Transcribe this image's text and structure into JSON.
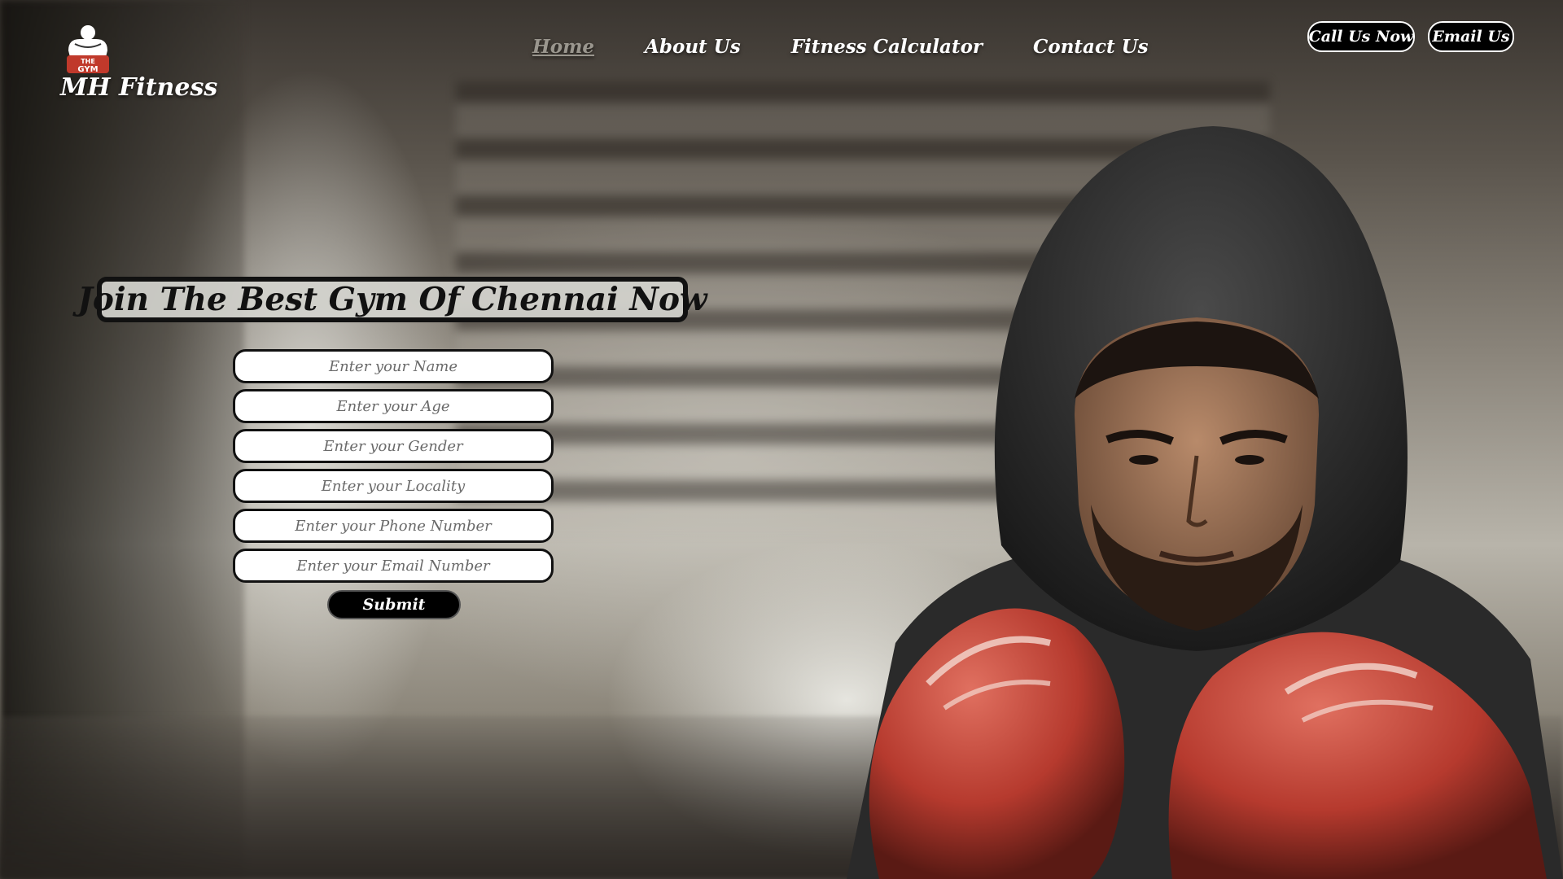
{
  "brand": {
    "logo_text_top": "THE",
    "logo_text_bottom": "GYM",
    "name": "MH Fitness"
  },
  "nav": {
    "items": [
      {
        "label": "Home",
        "active": true
      },
      {
        "label": "About Us",
        "active": false
      },
      {
        "label": "Fitness Calculator",
        "active": false
      },
      {
        "label": "Contact Us",
        "active": false
      }
    ]
  },
  "header_actions": {
    "call_label": "Call Us Now",
    "email_label": "Email Us"
  },
  "hero": {
    "title": "Join The Best Gym Of Chennai Now"
  },
  "form": {
    "fields": [
      {
        "placeholder": "Enter your Name",
        "value": ""
      },
      {
        "placeholder": "Enter your Age",
        "value": ""
      },
      {
        "placeholder": "Enter your Gender",
        "value": ""
      },
      {
        "placeholder": "Enter your Locality",
        "value": ""
      },
      {
        "placeholder": "Enter your Phone Number",
        "value": ""
      },
      {
        "placeholder": "Enter your Email Number",
        "value": ""
      }
    ],
    "submit_label": "Submit"
  },
  "colors": {
    "accent_dark": "#000000",
    "text_light": "#ffffff",
    "glove_red": "#c0392b",
    "hood_gray": "#2e2e2e"
  },
  "icons": {
    "logo": "gym-logo-icon"
  }
}
